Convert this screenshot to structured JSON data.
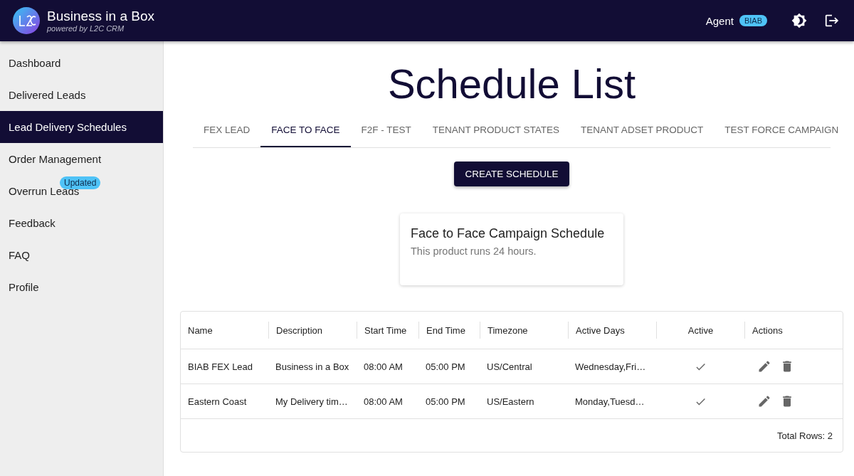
{
  "header": {
    "title": "Business in a Box",
    "subtitle": "powered by L2C CRM",
    "user": "Agent",
    "badge": "BIAB"
  },
  "sidebar": {
    "items": [
      {
        "label": "Dashboard",
        "selected": false
      },
      {
        "label": "Delivered Leads",
        "selected": false
      },
      {
        "label": "Lead Delivery Schedules",
        "selected": true
      },
      {
        "label": "Order Management",
        "selected": false
      },
      {
        "label": "Overrun Leads",
        "selected": false,
        "badge": "Updated"
      },
      {
        "label": "Feedback",
        "selected": false
      },
      {
        "label": "FAQ",
        "selected": false
      },
      {
        "label": "Profile",
        "selected": false
      }
    ]
  },
  "page_title": "Schedule List",
  "tabs": [
    {
      "label": "FEX LEAD",
      "selected": false
    },
    {
      "label": "FACE TO FACE",
      "selected": true
    },
    {
      "label": "F2F - TEST",
      "selected": false
    },
    {
      "label": "TENANT PRODUCT STATES",
      "selected": false
    },
    {
      "label": "TENANT ADSET PRODUCT",
      "selected": false
    },
    {
      "label": "TEST FORCE CAMPAIGN",
      "selected": false
    }
  ],
  "create_button": "CREATE SCHEDULE",
  "info_card": {
    "title": "Face to Face Campaign Schedule",
    "text": "This product runs 24 hours."
  },
  "table": {
    "columns": [
      "Name",
      "Description",
      "Start Time",
      "End Time",
      "Timezone",
      "Active Days",
      "Active",
      "Actions"
    ],
    "rows": [
      {
        "name": "BIAB FEX Lead",
        "description": "Business in a Box",
        "start": "08:00 AM",
        "end": "05:00 PM",
        "timezone": "US/Central",
        "days": "Wednesday,Fri…",
        "active": true
      },
      {
        "name": "Eastern Coast",
        "description": "My Delivery tim…",
        "start": "08:00 AM",
        "end": "05:00 PM",
        "timezone": "US/Eastern",
        "days": "Monday,Tuesd…",
        "active": true
      }
    ],
    "footer": "Total Rows: 2"
  }
}
